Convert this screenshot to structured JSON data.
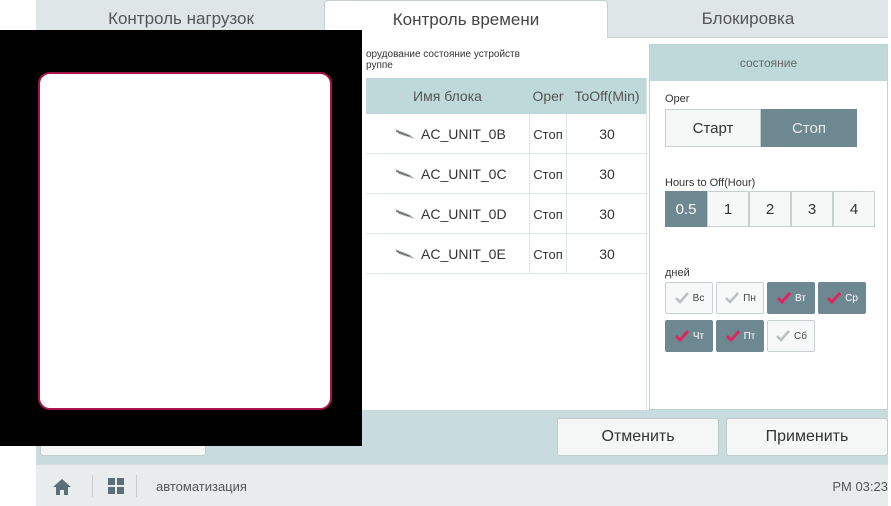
{
  "tabs": [
    {
      "label": "Контроль нагрузок",
      "active": false
    },
    {
      "label": "Контроль времени",
      "active": true
    },
    {
      "label": "Блокировка",
      "active": false
    }
  ],
  "group": {
    "title_line1": "орудование состояние устройств",
    "title_line2": "руппе"
  },
  "table": {
    "headers": {
      "name": "Имя блока",
      "oper": "Oper",
      "tooff": "ToOff(Min)"
    },
    "rows": [
      {
        "name": "AC_UNIT_0B",
        "oper": "Стоп",
        "tooff": "30"
      },
      {
        "name": "AC_UNIT_0C",
        "oper": "Стоп",
        "tooff": "30"
      },
      {
        "name": "AC_UNIT_0D",
        "oper": "Стоп",
        "tooff": "30"
      },
      {
        "name": "AC_UNIT_0E",
        "oper": "Стоп",
        "tooff": "30"
      }
    ]
  },
  "panel": {
    "header": "состояние",
    "oper_label": "Oper",
    "start": "Старт",
    "stop": "Стоп",
    "selected_oper": "Стоп",
    "hours_label": "Hours to Off(Hour)",
    "hours": [
      "0.5",
      "1",
      "2",
      "3",
      "4"
    ],
    "selected_hours": "0.5",
    "days_label": "дней",
    "days": [
      {
        "label": "Вс",
        "checked": false
      },
      {
        "label": "Пн",
        "checked": false
      },
      {
        "label": "Вт",
        "checked": true
      },
      {
        "label": "Ср",
        "checked": true
      },
      {
        "label": "Чт",
        "checked": true
      },
      {
        "label": "Пт",
        "checked": true
      },
      {
        "label": "Сб",
        "checked": false
      }
    ]
  },
  "actions": {
    "cancel": "Отменить",
    "apply": "Применить"
  },
  "status": {
    "breadcrumb": "автоматизация",
    "clock": "PM 03:23"
  },
  "colors": {
    "selected": "#6e8891",
    "header_bg": "#bfd8da",
    "preview_border": "#a8154a",
    "sunday": "#d8232a",
    "saturday": "#2a4fd8"
  }
}
